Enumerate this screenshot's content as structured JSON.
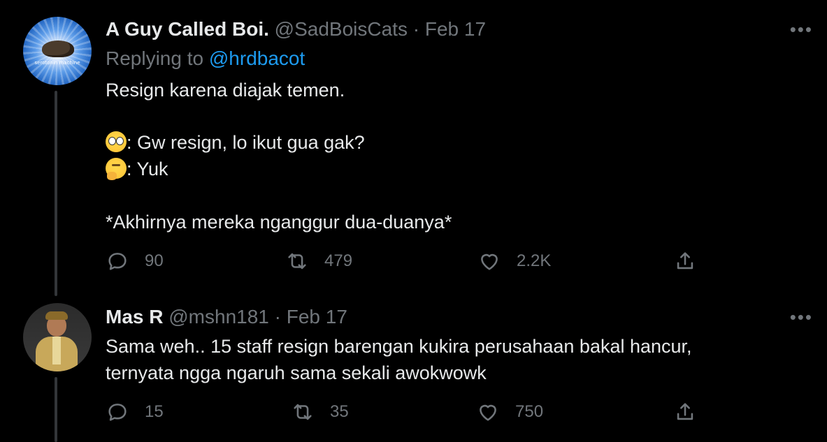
{
  "tweets": [
    {
      "name": "A Guy Called Boi.",
      "handle": "@SadBoisCats",
      "separator": "·",
      "date": "Feb 17",
      "replying_prefix": "Replying to",
      "replying_to": "@hrdbacot",
      "avatar_caption": "serotonin machine",
      "lines": [
        "Resign karena diajak temen.",
        ": Gw resign, lo ikut gua gak?",
        ": Yuk",
        "*Akhirnya mereka nganggur dua-duanya*"
      ],
      "emojis": [
        "flushed-face",
        "thinking-face"
      ],
      "replies": "90",
      "retweets": "479",
      "likes": "2.2K",
      "more": "•••"
    },
    {
      "name": "Mas R",
      "handle": "@mshn181",
      "separator": "·",
      "date": "Feb 17",
      "lines": [
        "Sama weh.. 15 staff resign barengan kukira perusahaan bakal hancur,",
        "ternyata ngga ngaruh sama sekali awokwowk"
      ],
      "replies": "15",
      "retweets": "35",
      "likes": "750",
      "more": "•••"
    }
  ],
  "colors": {
    "background": "#000000",
    "text": "#e7e9ea",
    "muted": "#71767b",
    "link": "#1d9bf0",
    "thread_line": "#333639"
  },
  "icons": [
    "reply-icon",
    "retweet-icon",
    "like-icon",
    "share-icon",
    "more-icon"
  ]
}
